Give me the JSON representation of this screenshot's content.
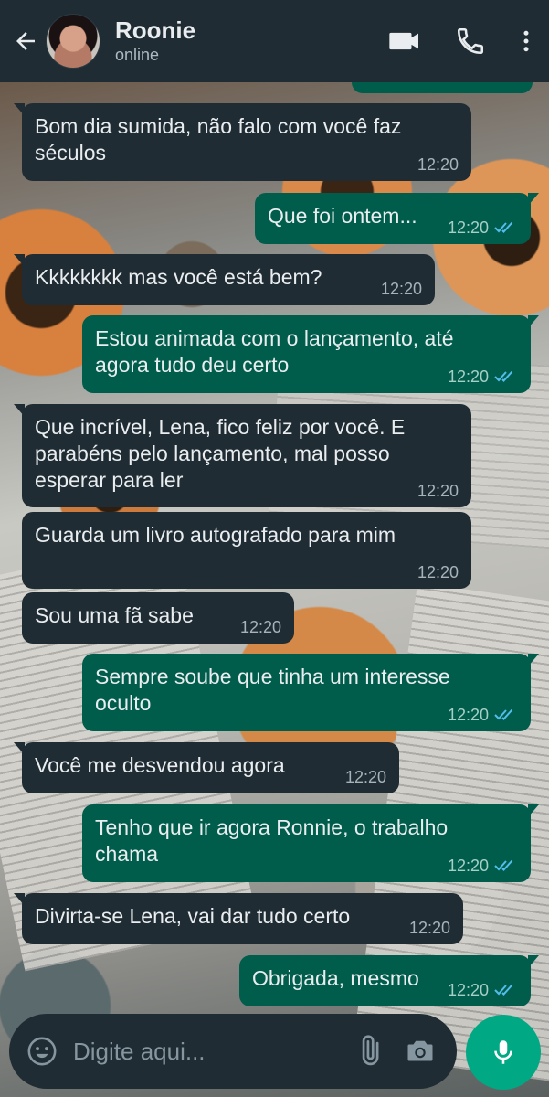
{
  "header": {
    "contact_name": "Roonie",
    "contact_status": "online",
    "icons": [
      "back-arrow-icon",
      "video-call-icon",
      "phone-icon",
      "more-options-icon"
    ]
  },
  "messages": [
    {
      "dir": "in",
      "text": "Bom dia sumida, não falo com você faz\nséculos",
      "time": "12:20"
    },
    {
      "dir": "out",
      "text": "Que foi ontem...",
      "time": "12:20",
      "status": "read"
    },
    {
      "dir": "in",
      "text": "Kkkkkkkk mas você está bem?",
      "time": "12:20"
    },
    {
      "dir": "out",
      "text": "Estou animada com o lançamento, até\nagora tudo deu certo",
      "time": "12:20",
      "status": "read"
    },
    {
      "dir": "in",
      "text": "Que incrível, Lena, fico feliz por você. E\nparabéns pelo lançamento, mal posso\nesperar para ler",
      "time": "12:20"
    },
    {
      "dir": "in",
      "text": "Guarda um livro autografado para mim",
      "time": "12:20"
    },
    {
      "dir": "in",
      "text": "Sou uma fã sabe",
      "time": "12:20"
    },
    {
      "dir": "out",
      "text": "Sempre soube que tinha um interesse\noculto",
      "time": "12:20",
      "status": "read"
    },
    {
      "dir": "in",
      "text": "Você me desvendou agora",
      "time": "12:20"
    },
    {
      "dir": "out",
      "text": "Tenho que ir agora Ronnie, o trabalho\nchama",
      "time": "12:20",
      "status": "read"
    },
    {
      "dir": "in",
      "text": "Divirta-se Lena, vai dar tudo certo",
      "time": "12:20"
    },
    {
      "dir": "out",
      "text": "Obrigada, mesmo",
      "time": "12:20",
      "status": "read"
    }
  ],
  "composer": {
    "placeholder": "Digite aqui...",
    "icons": [
      "emoji-icon",
      "attach-icon",
      "camera-icon",
      "microphone-icon"
    ]
  },
  "colors": {
    "header_bg": "#1f2c33",
    "incoming_bubble": "#202c33",
    "outgoing_bubble": "#005c4b",
    "read_ticks": "#53bdeb",
    "mic_button": "#00a884"
  }
}
